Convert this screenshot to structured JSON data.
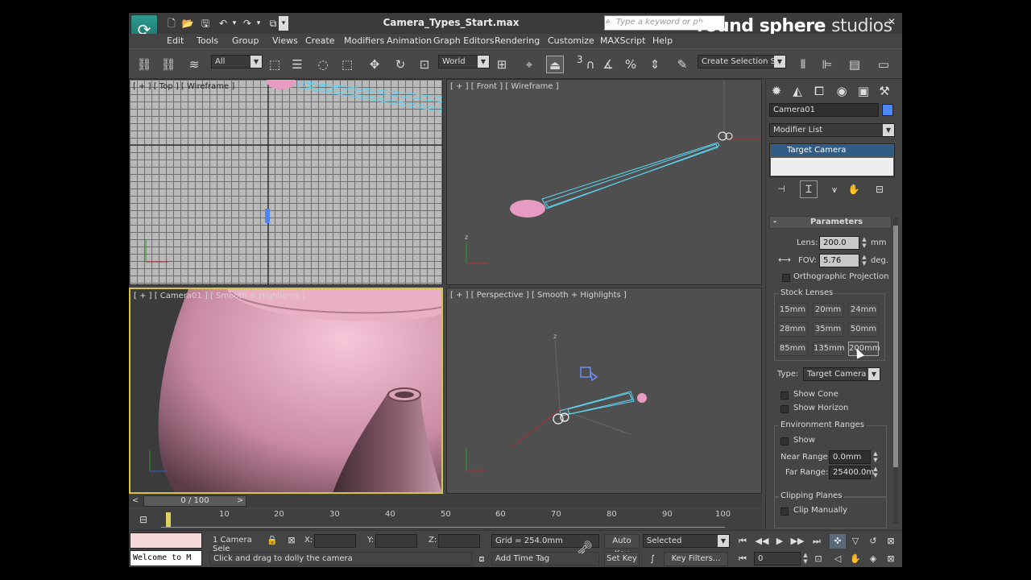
{
  "window": {
    "title": "Camera_Types_Start.max",
    "search_placeholder": "Type a keyword or ph",
    "brand_bold": "round sphere",
    "brand_light": "studios"
  },
  "menu": [
    "Edit",
    "Tools",
    "Group",
    "Views",
    "Create",
    "Modifiers",
    "Animation",
    "Graph Editors",
    "Rendering",
    "Customize",
    "MAXScript",
    "Help"
  ],
  "toolbar": {
    "selection_filter": "All",
    "ref_coord": "World",
    "named_selection": "Create Selection Se",
    "snap_label": "3"
  },
  "viewports": {
    "top": "[ + ] [ Top ] [ Wireframe ]",
    "front": "[ + ] [ Front ] [ Wireframe ]",
    "camera": "[ + ] [ Camera01 ] [ Smooth + Highlights ]",
    "perspective": "[ + ] [ Perspective ] [ Smooth + Highlights ]",
    "axis_z": "z"
  },
  "command_panel": {
    "object_name": "Camera01",
    "object_color": "#4f86f7",
    "modifier_list": "Modifier List",
    "stack_item": "Target Camera",
    "rollout_title": "Parameters",
    "rollout_toggle": "-",
    "lens_label": "Lens:",
    "lens_value": "200.0",
    "lens_unit": "mm",
    "fov_label": "FOV:",
    "fov_value": "5.76",
    "fov_unit": "deg.",
    "ortho_label": "Orthographic Projection",
    "stock_lenses_label": "Stock Lenses",
    "stock_lenses": [
      "15mm",
      "20mm",
      "24mm",
      "28mm",
      "35mm",
      "50mm",
      "85mm",
      "135mm",
      "200mm"
    ],
    "type_label": "Type:",
    "type_value": "Target Camera",
    "show_cone": "Show Cone",
    "show_horizon": "Show Horizon",
    "env_ranges_label": "Environment Ranges",
    "env_show": "Show",
    "near_label": "Near Range:",
    "near_value": "0.0mm",
    "far_label": "Far Range:",
    "far_value": "25400.0m",
    "clipping_label": "Clipping Planes",
    "clip_manually": "Clip Manually"
  },
  "timeline": {
    "frame": "0 / 100",
    "ticks": [
      "10",
      "20",
      "30",
      "40",
      "50",
      "60",
      "70",
      "80",
      "90",
      "100"
    ]
  },
  "status": {
    "selected": "1 Camera Sele",
    "x_label": "X:",
    "y_label": "Y:",
    "z_label": "Z:",
    "grid": "Grid = 254.0mm",
    "prompt": "Click and drag to dolly the camera",
    "add_time_tag": "Add Time Tag",
    "auto_key": "Auto Key",
    "set_key": "Set Key",
    "key_mode": "Selected",
    "key_filters": "Key Filters...",
    "current_frame": "0",
    "listener": "Welcome to M"
  }
}
